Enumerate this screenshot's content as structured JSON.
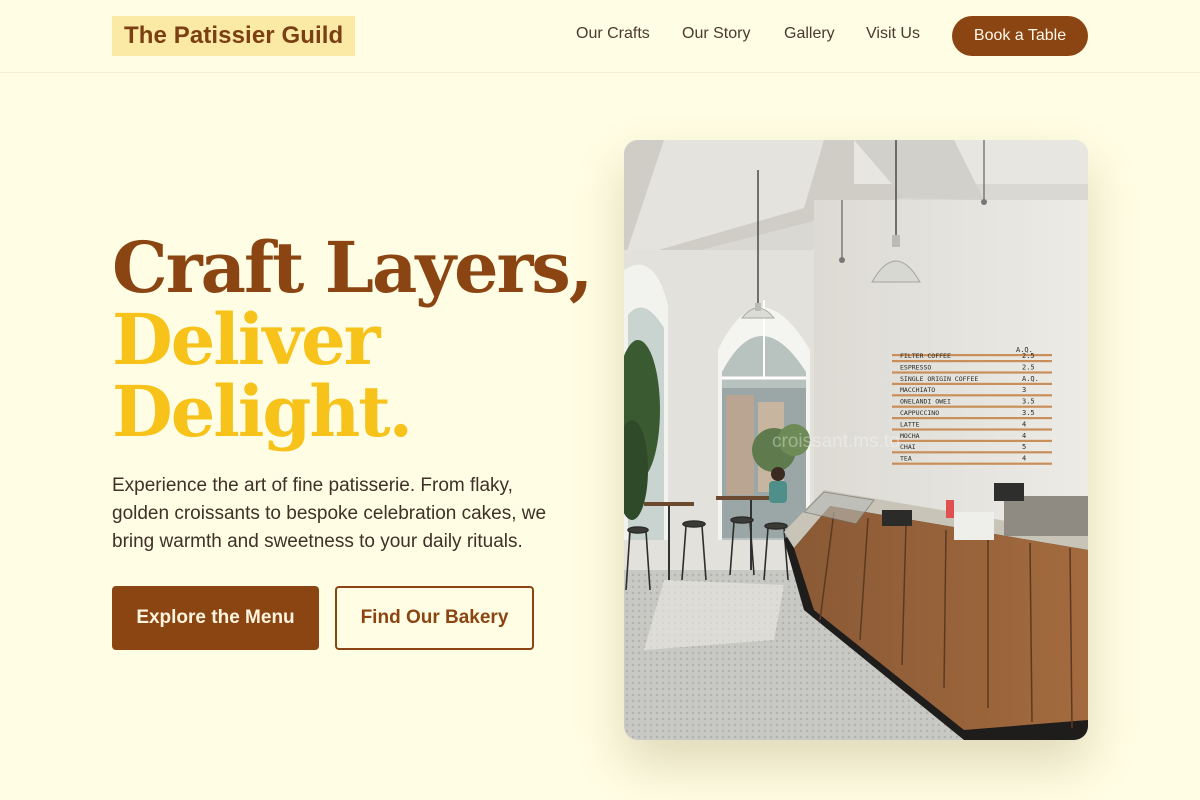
{
  "header": {
    "brand": "The Patissier Guild",
    "nav": [
      {
        "label": "Our Crafts"
      },
      {
        "label": "Our Story"
      },
      {
        "label": "Gallery"
      },
      {
        "label": "Visit Us"
      }
    ],
    "cta_label": "Book a Table"
  },
  "hero": {
    "headline_line1": "Craft Layers,",
    "headline_line2": "Deliver",
    "headline_line3": "Delight.",
    "subtitle": "Experience the art of fine patisserie. From flaky, golden croissants to bespoke celebration cakes, we bring warmth and sweetness to your daily rituals.",
    "primary_label": "Explore the Menu",
    "secondary_label": "Find Our Bakery",
    "image": {
      "watermark": "croissant.ms.to",
      "menu_board": [
        {
          "item": "FILTER COFFEE",
          "price": "2.5"
        },
        {
          "item": "ESPRESSO",
          "price": "2.5"
        },
        {
          "item": "SINGLE ORIGIN COFFEE",
          "price": "A.Q."
        },
        {
          "item": "MACCHIATO",
          "price": "3"
        },
        {
          "item": "ONELANDI OWEI",
          "price": "3.5"
        },
        {
          "item": "CAPPUCCINO",
          "price": "3.5"
        },
        {
          "item": "LATTE",
          "price": "4"
        },
        {
          "item": "MOCHA",
          "price": "4"
        },
        {
          "item": "CHAI",
          "price": "5"
        },
        {
          "item": "TEA",
          "price": "4"
        }
      ],
      "menu_board_extra_price": "A.Q."
    }
  },
  "colors": {
    "background": "#fffde3",
    "brand_brown": "#8b4513",
    "accent_yellow": "#f7c21a",
    "logo_highlight": "#fbeaa5"
  }
}
